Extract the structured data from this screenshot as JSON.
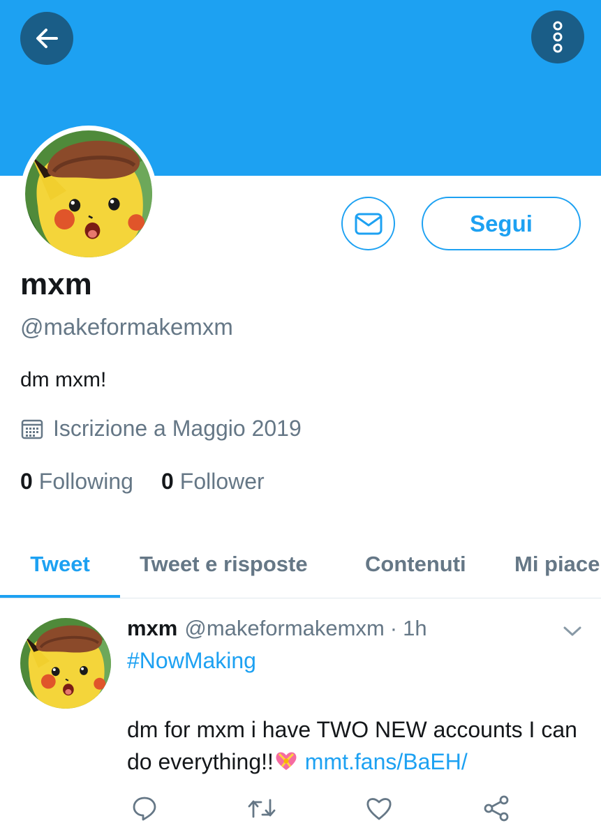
{
  "colors": {
    "accent": "#1da1f2",
    "banner": "#1da1f2",
    "icon_button_bg": "#1a5d87",
    "secondary_text": "#657786"
  },
  "header": {
    "back_icon": "arrow-left-icon",
    "more_icon": "more-vertical-icon"
  },
  "profile": {
    "name": "mxm",
    "handle": "@makeformakemxm",
    "bio": "dm mxm!",
    "joined": "Iscrizione a Maggio 2019",
    "following_count": "0",
    "following_label": "Following",
    "follower_count": "0",
    "follower_label": "Follower",
    "follow_button": "Segui",
    "message_icon": "mail-icon"
  },
  "tabs": [
    {
      "label": "Tweet",
      "active": true
    },
    {
      "label": "Tweet e risposte",
      "active": false
    },
    {
      "label": "Contenuti",
      "active": false
    },
    {
      "label": "Mi piace",
      "active": false
    }
  ],
  "tweet": {
    "name": "mxm",
    "handle": "@makeformakemxm",
    "separator": "·",
    "time": "1h",
    "hashtag": "#NowMaking",
    "text": "dm for mxm i have TWO NEW accounts I can do everything!!",
    "emoji": "heart-with-ribbon-icon",
    "link": "mmt.fans/BaEH/",
    "actions": [
      "reply-icon",
      "retweet-icon",
      "like-icon",
      "share-icon"
    ]
  }
}
